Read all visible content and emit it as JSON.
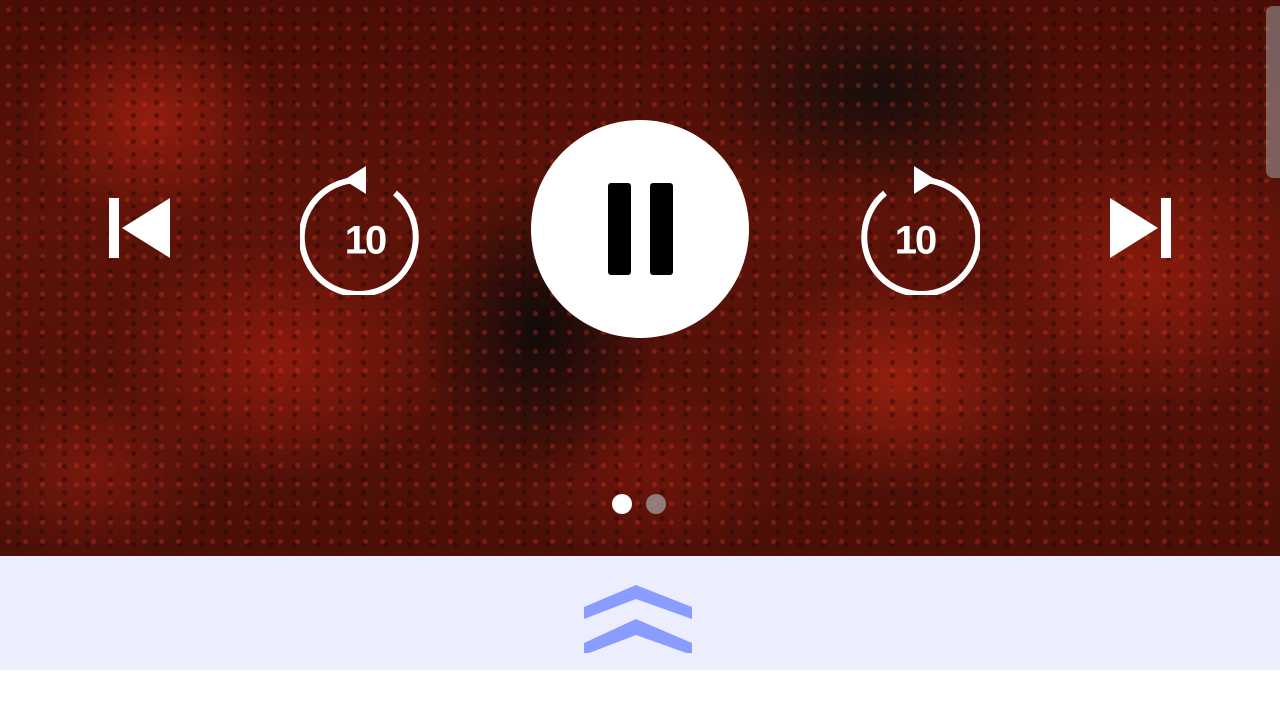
{
  "controls": {
    "rewind_seconds": "10",
    "forward_seconds": "10",
    "state": "playing"
  },
  "pager": {
    "total_pages": 2,
    "active_page": 1
  },
  "icons": {
    "previous": "skip-previous-icon",
    "rewind": "replay-10-icon",
    "pause": "pause-icon",
    "forward": "forward-10-icon",
    "next": "skip-next-icon",
    "expand": "double-chevron-up-icon"
  },
  "colors": {
    "icon": "#ffffff",
    "drawer_background": "#eceefe",
    "chevron": "#8a9cff"
  }
}
